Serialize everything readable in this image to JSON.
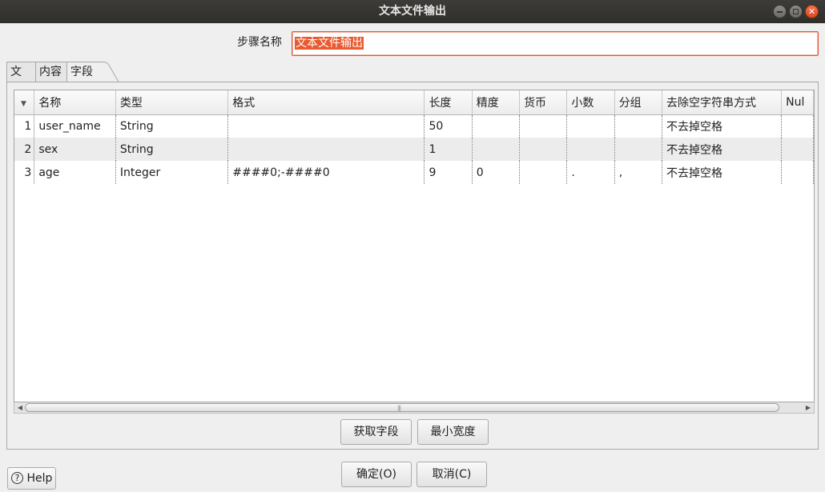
{
  "window": {
    "title": "文本文件输出"
  },
  "step_name": {
    "label": "步骤名称",
    "value": "文本文件输出"
  },
  "tabs": [
    {
      "label": "文件"
    },
    {
      "label": "内容"
    },
    {
      "label": "字段",
      "active": true
    }
  ],
  "grid": {
    "columns": [
      "名称",
      "类型",
      "格式",
      "长度",
      "精度",
      "货币",
      "小数",
      "分组",
      "去除空字符串方式",
      "Nul"
    ],
    "rows": [
      {
        "num": "1",
        "cells": [
          "user_name",
          "String",
          "",
          "50",
          "",
          "",
          "",
          "",
          "不去掉空格",
          ""
        ]
      },
      {
        "num": "2",
        "cells": [
          "sex",
          "String",
          "",
          "1",
          "",
          "",
          "",
          "",
          "不去掉空格",
          ""
        ]
      },
      {
        "num": "3",
        "cells": [
          "age",
          "Integer",
          "####0;-####0",
          "9",
          "0",
          "",
          ".",
          ",",
          "不去掉空格",
          ""
        ]
      }
    ]
  },
  "buttons": {
    "get_fields": "获取字段",
    "min_width": "最小宽度",
    "ok": "确定(O)",
    "cancel": "取消(C)",
    "help": "Help"
  },
  "colors": {
    "titlebar": "#2f2e2b",
    "selection": "#e95a30",
    "close_button": "#e05a2b"
  }
}
